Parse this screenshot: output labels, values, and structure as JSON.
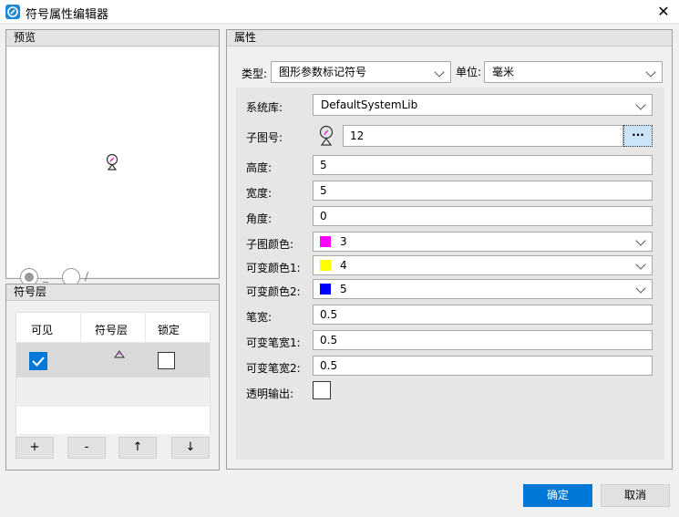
{
  "window": {
    "title": "符号属性编辑器"
  },
  "preview": {
    "header": "预览",
    "radio1_label": "_",
    "radio2_label": "/"
  },
  "layers": {
    "header": "符号层",
    "columns": [
      "可见",
      "符号层",
      "锁定"
    ],
    "buttons": {
      "add": "+",
      "remove": "-",
      "up": "↑",
      "down": "↓"
    }
  },
  "props": {
    "header": "属性",
    "type_label": "类型:",
    "type_value": "图形参数标记符号",
    "unit_label": "单位:",
    "unit_value": "毫米",
    "lib_label": "系统库:",
    "lib_value": "DefaultSystemLib",
    "sub_label": "子图号:",
    "sub_value": "12",
    "sub_button": "···",
    "height_label": "高度:",
    "height_value": "5",
    "width_label": "宽度:",
    "width_value": "5",
    "angle_label": "角度:",
    "angle_value": "0",
    "subcolor_label": "子图颜色:",
    "subcolor_value": "3",
    "subcolor_hex": "#ff00ff",
    "var1_label": "可变颜色1:",
    "var1_value": "4",
    "var1_hex": "#ffff00",
    "var2_label": "可变颜色2:",
    "var2_value": "5",
    "var2_hex": "#0000ff",
    "pen_label": "笔宽:",
    "pen_value": "0.5",
    "vpen1_label": "可变笔宽1:",
    "vpen1_value": "0.5",
    "vpen2_label": "可变笔宽2:",
    "vpen2_value": "0.5",
    "transparent_label": "透明输出:"
  },
  "footer": {
    "ok": "确定",
    "cancel": "取消"
  },
  "colors": {
    "accent": "#0078d7"
  }
}
